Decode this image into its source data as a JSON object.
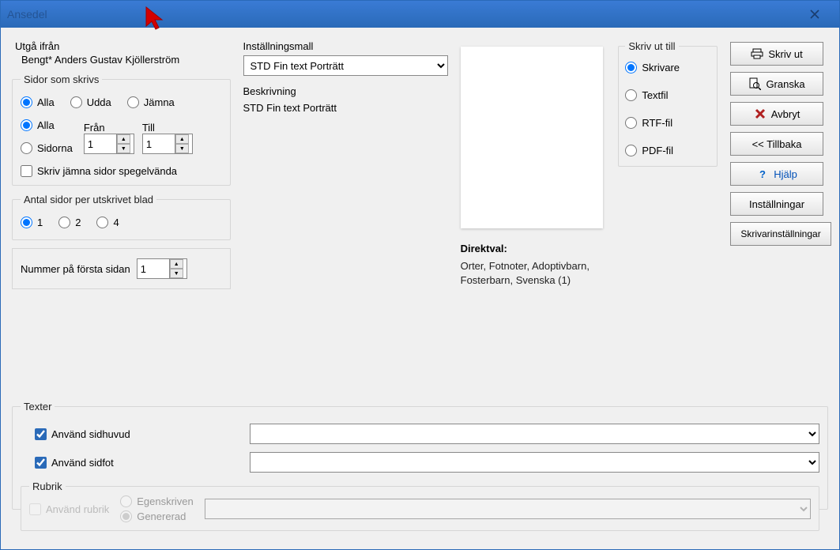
{
  "title": "Ansedel",
  "from": {
    "label": "Utgå ifrån",
    "value": "Bengt* Anders Gustav Kjöllerström"
  },
  "pages": {
    "legend": "Sidor som skrivs",
    "which": {
      "all": "Alla",
      "odd": "Udda",
      "even": "Jämna"
    },
    "range": {
      "all": "Alla",
      "sidorna": "Sidorna",
      "from": "Från",
      "to": "Till",
      "from_val": "1",
      "to_val": "1"
    },
    "mirror": "Skriv jämna sidor spegelvända"
  },
  "perSheet": {
    "legend": "Antal sidor per utskrivet blad",
    "o1": "1",
    "o2": "2",
    "o4": "4"
  },
  "firstPage": {
    "label": "Nummer på första sidan",
    "val": "1"
  },
  "template": {
    "label": "Inställningsmall",
    "value": "STD Fin text Porträtt",
    "descLabel": "Beskrivning",
    "descVal": "STD Fin text Porträtt"
  },
  "direct": {
    "label": "Direktval:",
    "text": "Orter, Fotnoter, Adoptivbarn, Fosterbarn, Svenska (1)"
  },
  "output": {
    "legend": "Skriv ut till",
    "printer": "Skrivare",
    "text": "Textfil",
    "rtf": "RTF-fil",
    "pdf": "PDF-fil"
  },
  "buttons": {
    "print": "Skriv ut",
    "preview": "Granska",
    "cancel": "Avbryt",
    "back": "<< Tillbaka",
    "help": "Hjälp",
    "settings": "Inställningar",
    "printerSettings": "Skrivarinställningar"
  },
  "texter": {
    "legend": "Texter",
    "header": "Använd sidhuvud",
    "footer": "Använd sidfot",
    "rubrik": {
      "legend": "Rubrik",
      "use": "Använd rubrik",
      "own": "Egenskriven",
      "gen": "Genererad"
    }
  }
}
